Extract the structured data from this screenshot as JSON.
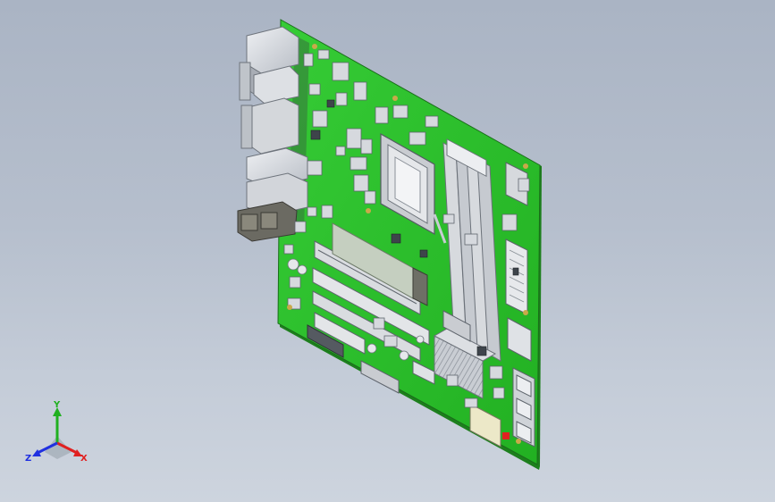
{
  "viewport": {
    "background_top": "#aab4c4",
    "background_bottom": "#cdd4de"
  },
  "model": {
    "subject": "motherboard-3d-model",
    "pcb_color": "#2ec22e",
    "component_color": "#d7dade"
  },
  "triad": {
    "x_label": "X",
    "y_label": "Y",
    "z_label": "Z",
    "x_color": "#e02020",
    "y_color": "#20b020",
    "z_color": "#2030e0"
  }
}
